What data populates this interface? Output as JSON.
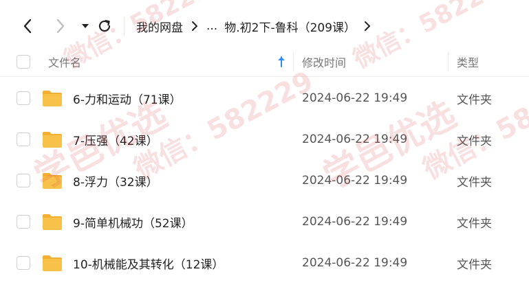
{
  "breadcrumb": {
    "root": "我的网盘",
    "ellipsis": "...",
    "current": "物.初2下-鲁科（209课）"
  },
  "header": {
    "name_label": "文件名",
    "time_label": "修改时间",
    "type_label": "类型"
  },
  "rows": [
    {
      "name": "6-力和运动（71课）",
      "time": "2024-06-22 19:49",
      "type": "文件夹"
    },
    {
      "name": "7-压强（42课）",
      "time": "2024-06-22 19:49",
      "type": "文件夹"
    },
    {
      "name": "8-浮力（32课）",
      "time": "2024-06-22 19:49",
      "type": "文件夹"
    },
    {
      "name": "9-简单机械功（52课）",
      "time": "2024-06-22 19:49",
      "type": "文件夹"
    },
    {
      "name": "10-机械能及其转化（12课）",
      "time": "2024-06-22 19:49",
      "type": "文件夹"
    }
  ],
  "watermark": {
    "brand": "学邑优选",
    "contact": "微信：582229"
  },
  "colors": {
    "folder": "#f8c24a",
    "folder_tab": "#f2b033",
    "sort_arrow": "#2b8cf7",
    "watermark": "#dc3c3c"
  }
}
